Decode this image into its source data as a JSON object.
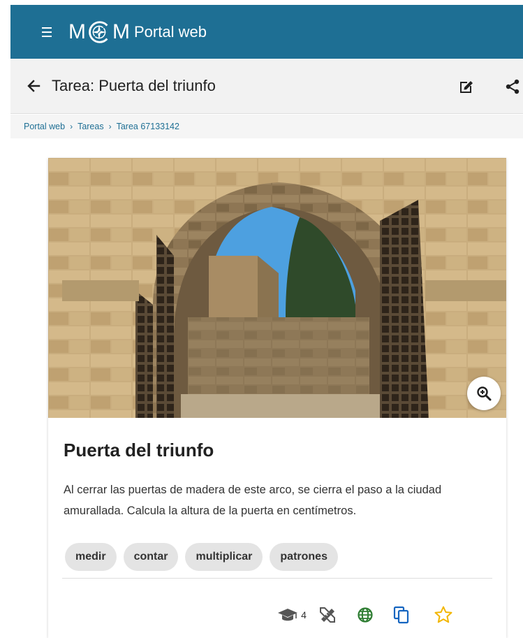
{
  "app": {
    "logo_text_left": "M",
    "logo_text_right": "M",
    "title": "Portal web",
    "brand_color": "#1e6f94"
  },
  "toolbar": {
    "title": "Tarea: Puerta del triunfo",
    "back_icon": "arrow-left-icon",
    "edit_icon": "edit-icon",
    "share_icon": "share-icon"
  },
  "breadcrumb": {
    "items": [
      "Portal web",
      "Tareas",
      "Tarea 67133142"
    ],
    "separator": "›"
  },
  "task": {
    "title": "Puerta del triunfo",
    "description": "Al cerrar las puertas de madera de este arco, se cierra el paso a la ciudad amurallada. Calcula la altura de la puerta en centímetros.",
    "tags": [
      "medir",
      "contar",
      "multiplicar",
      "patrones"
    ],
    "level": "4",
    "icons": [
      "graduation-cap-icon",
      "ruler-pencil-icon",
      "globe-icon",
      "copy-icon",
      "star-icon",
      "zoom-in-icon"
    ]
  }
}
